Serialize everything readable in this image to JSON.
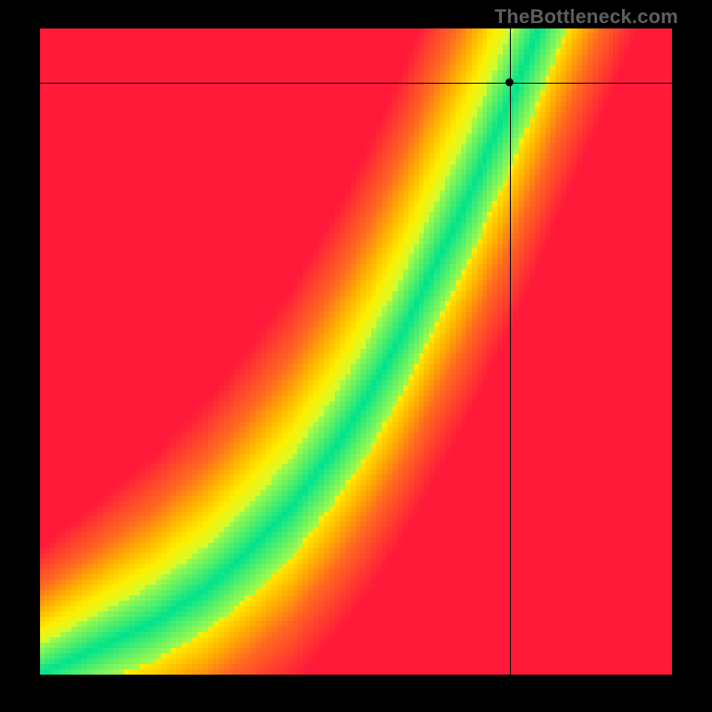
{
  "watermark": "TheBottleneck.com",
  "chart_data": {
    "type": "heatmap",
    "title": "",
    "xlabel": "",
    "ylabel": "",
    "xlim": [
      0,
      1
    ],
    "ylim": [
      0,
      1
    ],
    "grid": false,
    "legend": "none",
    "color_stops": [
      {
        "t": 0.0,
        "color": "#ff1a3a"
      },
      {
        "t": 0.35,
        "color": "#ff6a1f"
      },
      {
        "t": 0.55,
        "color": "#ffb400"
      },
      {
        "t": 0.72,
        "color": "#ffee00"
      },
      {
        "t": 0.88,
        "color": "#c8ff3a"
      },
      {
        "t": 1.0,
        "color": "#00e38d"
      }
    ],
    "ridge_points": [
      {
        "x": 0.0,
        "y": 0.0
      },
      {
        "x": 0.09,
        "y": 0.04
      },
      {
        "x": 0.18,
        "y": 0.08
      },
      {
        "x": 0.26,
        "y": 0.13
      },
      {
        "x": 0.33,
        "y": 0.19
      },
      {
        "x": 0.4,
        "y": 0.26
      },
      {
        "x": 0.46,
        "y": 0.34
      },
      {
        "x": 0.52,
        "y": 0.43
      },
      {
        "x": 0.57,
        "y": 0.52
      },
      {
        "x": 0.62,
        "y": 0.62
      },
      {
        "x": 0.67,
        "y": 0.72
      },
      {
        "x": 0.71,
        "y": 0.81
      },
      {
        "x": 0.75,
        "y": 0.9
      },
      {
        "x": 0.79,
        "y": 1.0
      }
    ],
    "marker": {
      "x": 0.743,
      "y": 0.916
    },
    "crosshair": {
      "x": 0.743,
      "y": 0.916
    },
    "resolution": {
      "cols": 120,
      "rows": 123
    }
  }
}
